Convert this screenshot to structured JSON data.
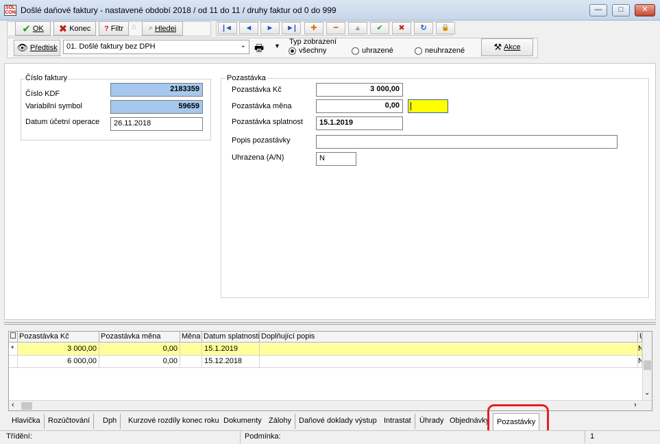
{
  "window": {
    "title": "Došlé daňové faktury - nastavené období 2018 / od 11 do 11 / druhy faktur od 0 do 999",
    "app_icon_text_top": "SOL",
    "app_icon_text_bottom": "CON",
    "minimize": "—",
    "maximize": "□",
    "close": "✕"
  },
  "toolbar1": {
    "ok_label": "OK",
    "konec_label": "Konec",
    "filtr_label": "Filtr",
    "hledej_label": "Hledej",
    "nav_first": "|◄",
    "nav_prev": "◄",
    "nav_next": "►",
    "nav_last": "►|",
    "nav_add": "✚",
    "nav_delete": "━",
    "nav_edit": "▲",
    "nav_post": "✔",
    "nav_cancel": "✖",
    "nav_refresh": "↻",
    "nav_lock": "🔒"
  },
  "toolbar2": {
    "predtisk_label": "Předtisk",
    "report_selected": "01. Došlé faktury bez DPH",
    "view_group_label": "Typ zobrazení",
    "view_options": [
      "všechny",
      "uhrazené",
      "neuhrazené"
    ],
    "view_selected": "všechny",
    "akce_label": "Akce"
  },
  "form": {
    "cislo_group": "Číslo faktury",
    "cislo_kdf_label": "Číslo KDF",
    "cislo_kdf_value": "2183359",
    "vs_label": "Variabilní symbol",
    "vs_value": "59659",
    "datum_label": "Datum účetní operace",
    "datum_value": "26.11.2018",
    "pozastavka_group": "Pozastávka",
    "poz_kc_label": "Pozastávka Kč",
    "poz_kc_value": "3 000,00",
    "poz_mena_label": "Pozastávka měna",
    "poz_mena_value": "0,00",
    "poz_mena_code": "",
    "poz_splatnost_label": "Pozastávka splatnost",
    "poz_splatnost_value": "15.1.2019",
    "popis_label": "Popis pozastávky",
    "popis_value": "",
    "uhrazena_label": "Uhrazena (A/N)",
    "uhrazena_value": "N"
  },
  "grid": {
    "columns": [
      "Pozastávka Kč",
      "Pozastávka měna",
      "Měna",
      "Datum splatnosti",
      "Doplňující popis",
      "U"
    ],
    "rows": [
      {
        "marker": "*",
        "kc": "3 000,00",
        "mena_val": "0,00",
        "mena": "",
        "datum": "15.1.2019",
        "popis": "",
        "u": "N"
      },
      {
        "marker": "",
        "kc": "6 000,00",
        "mena_val": "0,00",
        "mena": "",
        "datum": "15.12.2018",
        "popis": "",
        "u": "N"
      }
    ]
  },
  "tabs": [
    "Hlavička",
    "Rozúčtování",
    "Dph",
    "Kurzové rozdíly konec roku",
    "Dokumenty",
    "Zálohy",
    "Daňové doklady výstup",
    "Intrastat",
    "Úhrady",
    "Objednávky",
    "Pozastávky"
  ],
  "active_tab": "Pozastávky",
  "status": {
    "trideni_label": "Třídění:",
    "podminka_label": "Podmínka:",
    "record": "1"
  },
  "colors": {
    "highlight_row": "#ffff99",
    "blue_field": "#a6c8ee",
    "yellow_field": "#ffff00",
    "annotation_red": "#e0201c"
  }
}
